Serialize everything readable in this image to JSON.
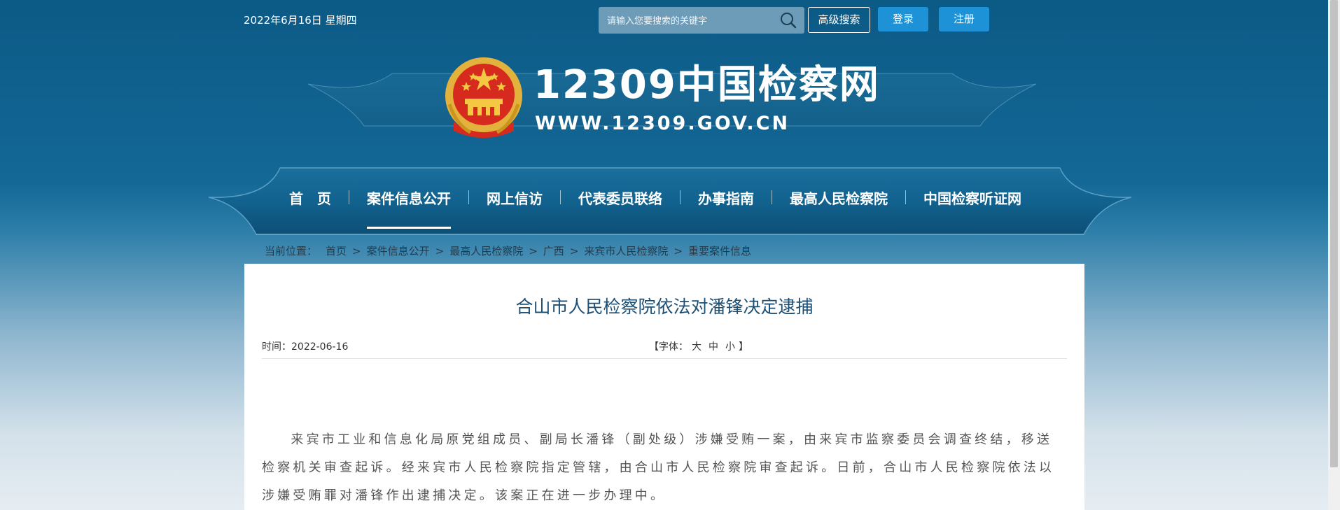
{
  "header": {
    "date": "2022年6月16日 星期四",
    "search_placeholder": "请输入您要搜索的关键字",
    "advanced_search": "高级搜索",
    "login": "登录",
    "register": "注册"
  },
  "logo": {
    "title": "12309中国检察网",
    "url": "WWW.12309.GOV.CN"
  },
  "nav": {
    "items": [
      {
        "label": "首　页"
      },
      {
        "label": "案件信息公开"
      },
      {
        "label": "网上信访"
      },
      {
        "label": "代表委员联络"
      },
      {
        "label": "办事指南"
      },
      {
        "label": "最高人民检察院"
      },
      {
        "label": "中国检察听证网"
      }
    ],
    "active_index": 1
  },
  "breadcrumb": {
    "label": "当前位置：",
    "items": [
      "首页",
      "案件信息公开",
      "最高人民检察院",
      "广西",
      "来宾市人民检察院",
      "重要案件信息"
    ]
  },
  "article": {
    "title": "合山市人民检察院依法对潘锋决定逮捕",
    "time": "时间：2022-06-16",
    "font_label_open": "【字体：",
    "font_large": "大",
    "font_medium": "中",
    "font_small": "小",
    "font_label_close": "】",
    "body": "来宾市工业和信息化局原党组成员、副局长潘锋（副处级）涉嫌受贿一案，由来宾市监察委员会调查终结，移送检察机关审查起诉。经来宾市人民检察院指定管辖，由合山市人民检察院审查起诉。日前，合山市人民检察院依法以涉嫌受贿罪对潘锋作出逮捕决定。该案正在进一步办理中。"
  },
  "colors": {
    "header_bg": "#0c5a86",
    "button_blue": "#1e92d6",
    "title_blue": "#1d4f74"
  }
}
